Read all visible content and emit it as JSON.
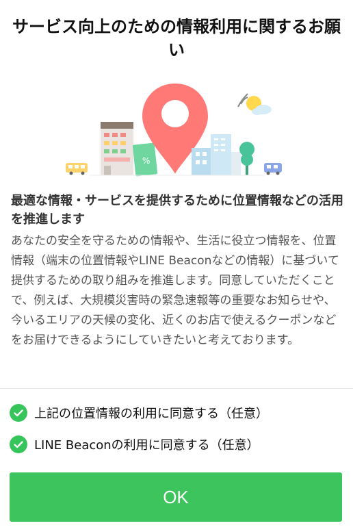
{
  "header": {
    "title": "サービス向上のための情報利用に関するお願い"
  },
  "content": {
    "headline": "最適な情報・サービスを提供するために位置情報などの活用を推進します",
    "body": "あなたの安全を守るための情報や、生活に役立つ情報を、位置情報（端末の位置情報やLINE Beaconなどの情報）に基づいて提供するための取り組みを推進します。同意していただくことで、例えば、大規模災害時の緊急速報等の重要なお知らせや、今いるエリアの天候の変化、近くのお店で使えるクーポンなどをお届けできるようにしていきたいと考えております。"
  },
  "consents": [
    {
      "label": "上記の位置情報の利用に同意する（任意）",
      "checked": true
    },
    {
      "label": "LINE Beaconの利用に同意する（任意）",
      "checked": true
    }
  ],
  "actions": {
    "ok_label": "OK"
  },
  "colors": {
    "accent_green": "#3ec45c",
    "pin_red": "#ff7a76"
  }
}
